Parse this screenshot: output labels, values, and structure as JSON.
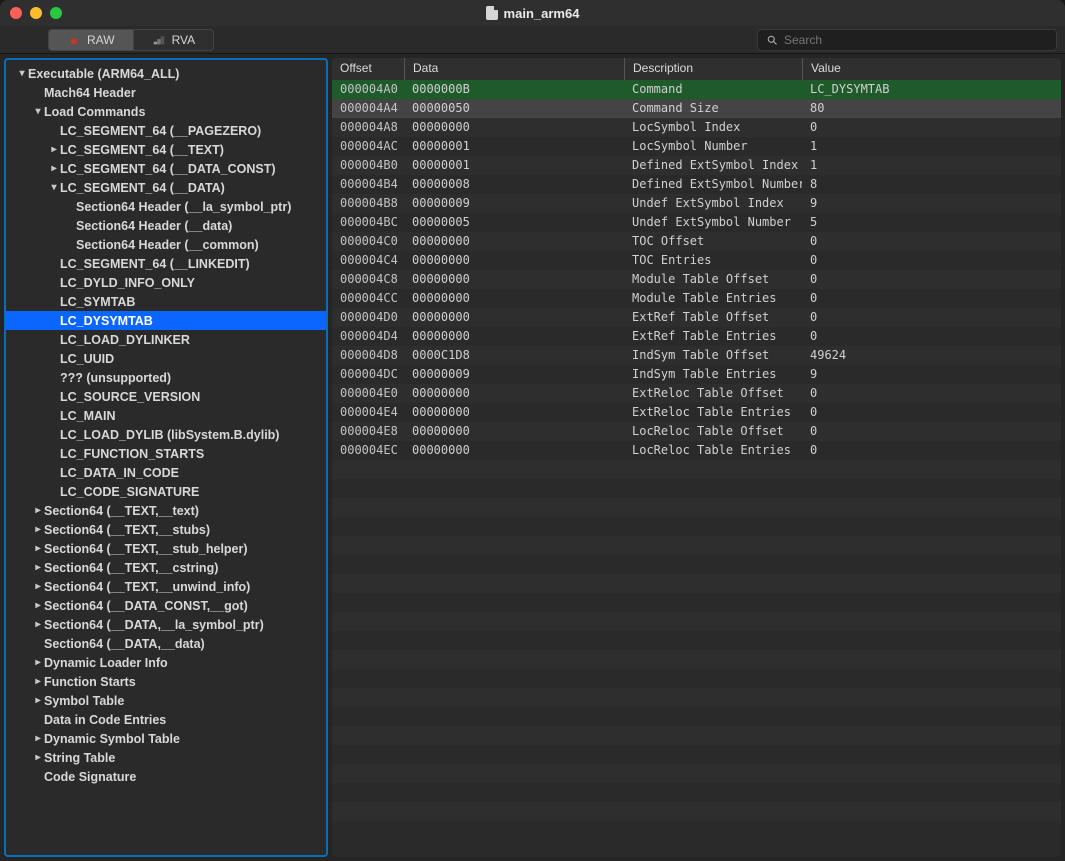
{
  "window": {
    "title": "main_arm64"
  },
  "toolbar": {
    "tabs": {
      "raw": "RAW",
      "rva": "RVA"
    },
    "search_placeholder": "Search"
  },
  "tree": [
    {
      "depth": 0,
      "arrow": "down",
      "label": "Executable  (ARM64_ALL)"
    },
    {
      "depth": 1,
      "arrow": "none",
      "label": "Mach64 Header"
    },
    {
      "depth": 1,
      "arrow": "down",
      "label": "Load Commands"
    },
    {
      "depth": 2,
      "arrow": "none",
      "label": "LC_SEGMENT_64  (__PAGEZERO)"
    },
    {
      "depth": 2,
      "arrow": "right",
      "label": "LC_SEGMENT_64  (__TEXT)"
    },
    {
      "depth": 2,
      "arrow": "right",
      "label": "LC_SEGMENT_64  (__DATA_CONST)"
    },
    {
      "depth": 2,
      "arrow": "down",
      "label": "LC_SEGMENT_64  (__DATA)"
    },
    {
      "depth": 3,
      "arrow": "none",
      "label": "Section64 Header (__la_symbol_ptr)"
    },
    {
      "depth": 3,
      "arrow": "none",
      "label": "Section64 Header (__data)"
    },
    {
      "depth": 3,
      "arrow": "none",
      "label": "Section64 Header (__common)"
    },
    {
      "depth": 2,
      "arrow": "none",
      "label": "LC_SEGMENT_64  (__LINKEDIT)"
    },
    {
      "depth": 2,
      "arrow": "none",
      "label": "LC_DYLD_INFO_ONLY"
    },
    {
      "depth": 2,
      "arrow": "none",
      "label": "LC_SYMTAB"
    },
    {
      "depth": 2,
      "arrow": "none",
      "label": "LC_DYSYMTAB",
      "selected": true
    },
    {
      "depth": 2,
      "arrow": "none",
      "label": "LC_LOAD_DYLINKER"
    },
    {
      "depth": 2,
      "arrow": "none",
      "label": "LC_UUID"
    },
    {
      "depth": 2,
      "arrow": "none",
      "label": "??? (unsupported)"
    },
    {
      "depth": 2,
      "arrow": "none",
      "label": "LC_SOURCE_VERSION"
    },
    {
      "depth": 2,
      "arrow": "none",
      "label": "LC_MAIN"
    },
    {
      "depth": 2,
      "arrow": "none",
      "label": "LC_LOAD_DYLIB (libSystem.B.dylib)"
    },
    {
      "depth": 2,
      "arrow": "none",
      "label": "LC_FUNCTION_STARTS"
    },
    {
      "depth": 2,
      "arrow": "none",
      "label": "LC_DATA_IN_CODE"
    },
    {
      "depth": 2,
      "arrow": "none",
      "label": "LC_CODE_SIGNATURE"
    },
    {
      "depth": 1,
      "arrow": "right",
      "label": "Section64 (__TEXT,__text)"
    },
    {
      "depth": 1,
      "arrow": "right",
      "label": "Section64 (__TEXT,__stubs)"
    },
    {
      "depth": 1,
      "arrow": "right",
      "label": "Section64 (__TEXT,__stub_helper)"
    },
    {
      "depth": 1,
      "arrow": "right",
      "label": "Section64 (__TEXT,__cstring)"
    },
    {
      "depth": 1,
      "arrow": "right",
      "label": "Section64 (__TEXT,__unwind_info)"
    },
    {
      "depth": 1,
      "arrow": "right",
      "label": "Section64 (__DATA_CONST,__got)"
    },
    {
      "depth": 1,
      "arrow": "right",
      "label": "Section64 (__DATA,__la_symbol_ptr)"
    },
    {
      "depth": 1,
      "arrow": "none",
      "label": "Section64 (__DATA,__data)"
    },
    {
      "depth": 1,
      "arrow": "right",
      "label": "Dynamic Loader Info"
    },
    {
      "depth": 1,
      "arrow": "right",
      "label": "Function Starts"
    },
    {
      "depth": 1,
      "arrow": "right",
      "label": "Symbol Table"
    },
    {
      "depth": 1,
      "arrow": "none",
      "label": "Data in Code Entries"
    },
    {
      "depth": 1,
      "arrow": "right",
      "label": "Dynamic Symbol Table"
    },
    {
      "depth": 1,
      "arrow": "right",
      "label": "String Table"
    },
    {
      "depth": 1,
      "arrow": "none",
      "label": "Code Signature"
    }
  ],
  "detail": {
    "columns": [
      "Offset",
      "Data",
      "Description",
      "Value"
    ],
    "rows": [
      {
        "offset": "000004A0",
        "data": "0000000B",
        "desc": "Command",
        "value": "LC_DYSYMTAB",
        "sel": "sel"
      },
      {
        "offset": "000004A4",
        "data": "00000050",
        "desc": "Command Size",
        "value": "80",
        "sel": "sel2"
      },
      {
        "offset": "000004A8",
        "data": "00000000",
        "desc": "LocSymbol Index",
        "value": "0"
      },
      {
        "offset": "000004AC",
        "data": "00000001",
        "desc": "LocSymbol Number",
        "value": "1"
      },
      {
        "offset": "000004B0",
        "data": "00000001",
        "desc": "Defined ExtSymbol Index",
        "value": "1"
      },
      {
        "offset": "000004B4",
        "data": "00000008",
        "desc": "Defined ExtSymbol Number",
        "value": "8"
      },
      {
        "offset": "000004B8",
        "data": "00000009",
        "desc": "Undef ExtSymbol Index",
        "value": "9"
      },
      {
        "offset": "000004BC",
        "data": "00000005",
        "desc": "Undef ExtSymbol Number",
        "value": "5"
      },
      {
        "offset": "000004C0",
        "data": "00000000",
        "desc": "TOC Offset",
        "value": "0"
      },
      {
        "offset": "000004C4",
        "data": "00000000",
        "desc": "TOC Entries",
        "value": "0"
      },
      {
        "offset": "000004C8",
        "data": "00000000",
        "desc": "Module Table Offset",
        "value": "0"
      },
      {
        "offset": "000004CC",
        "data": "00000000",
        "desc": "Module Table Entries",
        "value": "0"
      },
      {
        "offset": "000004D0",
        "data": "00000000",
        "desc": "ExtRef Table Offset",
        "value": "0"
      },
      {
        "offset": "000004D4",
        "data": "00000000",
        "desc": "ExtRef Table Entries",
        "value": "0"
      },
      {
        "offset": "000004D8",
        "data": "0000C1D8",
        "desc": "IndSym Table Offset",
        "value": "49624"
      },
      {
        "offset": "000004DC",
        "data": "00000009",
        "desc": "IndSym Table Entries",
        "value": "9"
      },
      {
        "offset": "000004E0",
        "data": "00000000",
        "desc": "ExtReloc Table Offset",
        "value": "0"
      },
      {
        "offset": "000004E4",
        "data": "00000000",
        "desc": "ExtReloc Table Entries",
        "value": "0"
      },
      {
        "offset": "000004E8",
        "data": "00000000",
        "desc": "LocReloc Table Offset",
        "value": "0"
      },
      {
        "offset": "000004EC",
        "data": "00000000",
        "desc": "LocReloc Table Entries",
        "value": "0"
      }
    ],
    "blank_rows": 20
  }
}
